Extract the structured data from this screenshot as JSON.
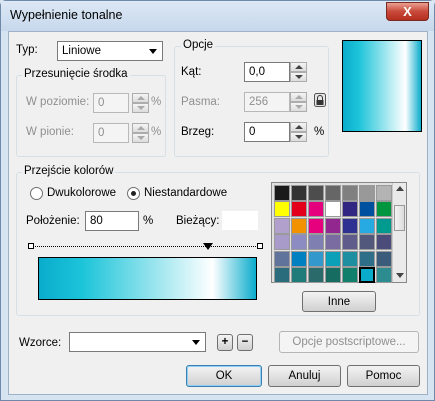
{
  "window": {
    "title": "Wypełnienie tonalne",
    "close_label": "X"
  },
  "type": {
    "label": "Typ:",
    "value": "Liniowe"
  },
  "center_offset": {
    "title": "Przesunięcie środka",
    "horizontal_label": "W poziomie:",
    "horizontal_value": "0",
    "horizontal_unit": "%",
    "vertical_label": "W pionie:",
    "vertical_value": "0",
    "vertical_unit": "%"
  },
  "options": {
    "title": "Opcje",
    "angle_label": "Kąt:",
    "angle_value": "0,0",
    "steps_label": "Pasma:",
    "steps_value": "256",
    "edge_label": "Brzeg:",
    "edge_value": "0",
    "edge_unit": "%"
  },
  "blend": {
    "title": "Przejście kolorów",
    "two_color_label": "Dwukolorowe",
    "custom_label": "Niestandardowe",
    "selected": "custom",
    "position_label": "Położenie:",
    "position_value": "80",
    "position_unit": "%",
    "current_label": "Bieżący:",
    "gradient_colors": [
      "#0aaccc",
      "#1cc4d9",
      "#ffffff",
      "#0aaccc"
    ],
    "other_button": "Inne"
  },
  "palette": {
    "colors": [
      "#1a1a1a",
      "#333333",
      "#4d4d4d",
      "#666666",
      "#808080",
      "#999999",
      "#b3b3b3",
      "#ffff00",
      "#e2001a",
      "#e5007e",
      "#ffffff",
      "#312783",
      "#0050a0",
      "#009640",
      "#b2a0cc",
      "#f39200",
      "#e6007e",
      "#92278f",
      "#2e3192",
      "#27aae1",
      "#009a8f",
      "#a99bc9",
      "#8c8cc2",
      "#7f7fb2",
      "#7a6ca0",
      "#5f5c8c",
      "#52577c",
      "#4c4c7a",
      "#60739b",
      "#0080c0",
      "#3399cc",
      "#0c9fb8",
      "#1d8fa0",
      "#2e6e88",
      "#3a5b7a",
      "#2a6b7c",
      "#1f7a7a",
      "#2a6a6a",
      "#166c60",
      "#107f6c",
      "#0aaccc",
      "#2c8c90"
    ],
    "selected_index": 40
  },
  "presets": {
    "label": "Wzorce:",
    "value": "",
    "add_label": "+",
    "remove_label": "−",
    "postscript_button": "Opcje postscriptowe..."
  },
  "buttons": {
    "ok": "OK",
    "cancel": "Anuluj",
    "help": "Pomoc"
  }
}
